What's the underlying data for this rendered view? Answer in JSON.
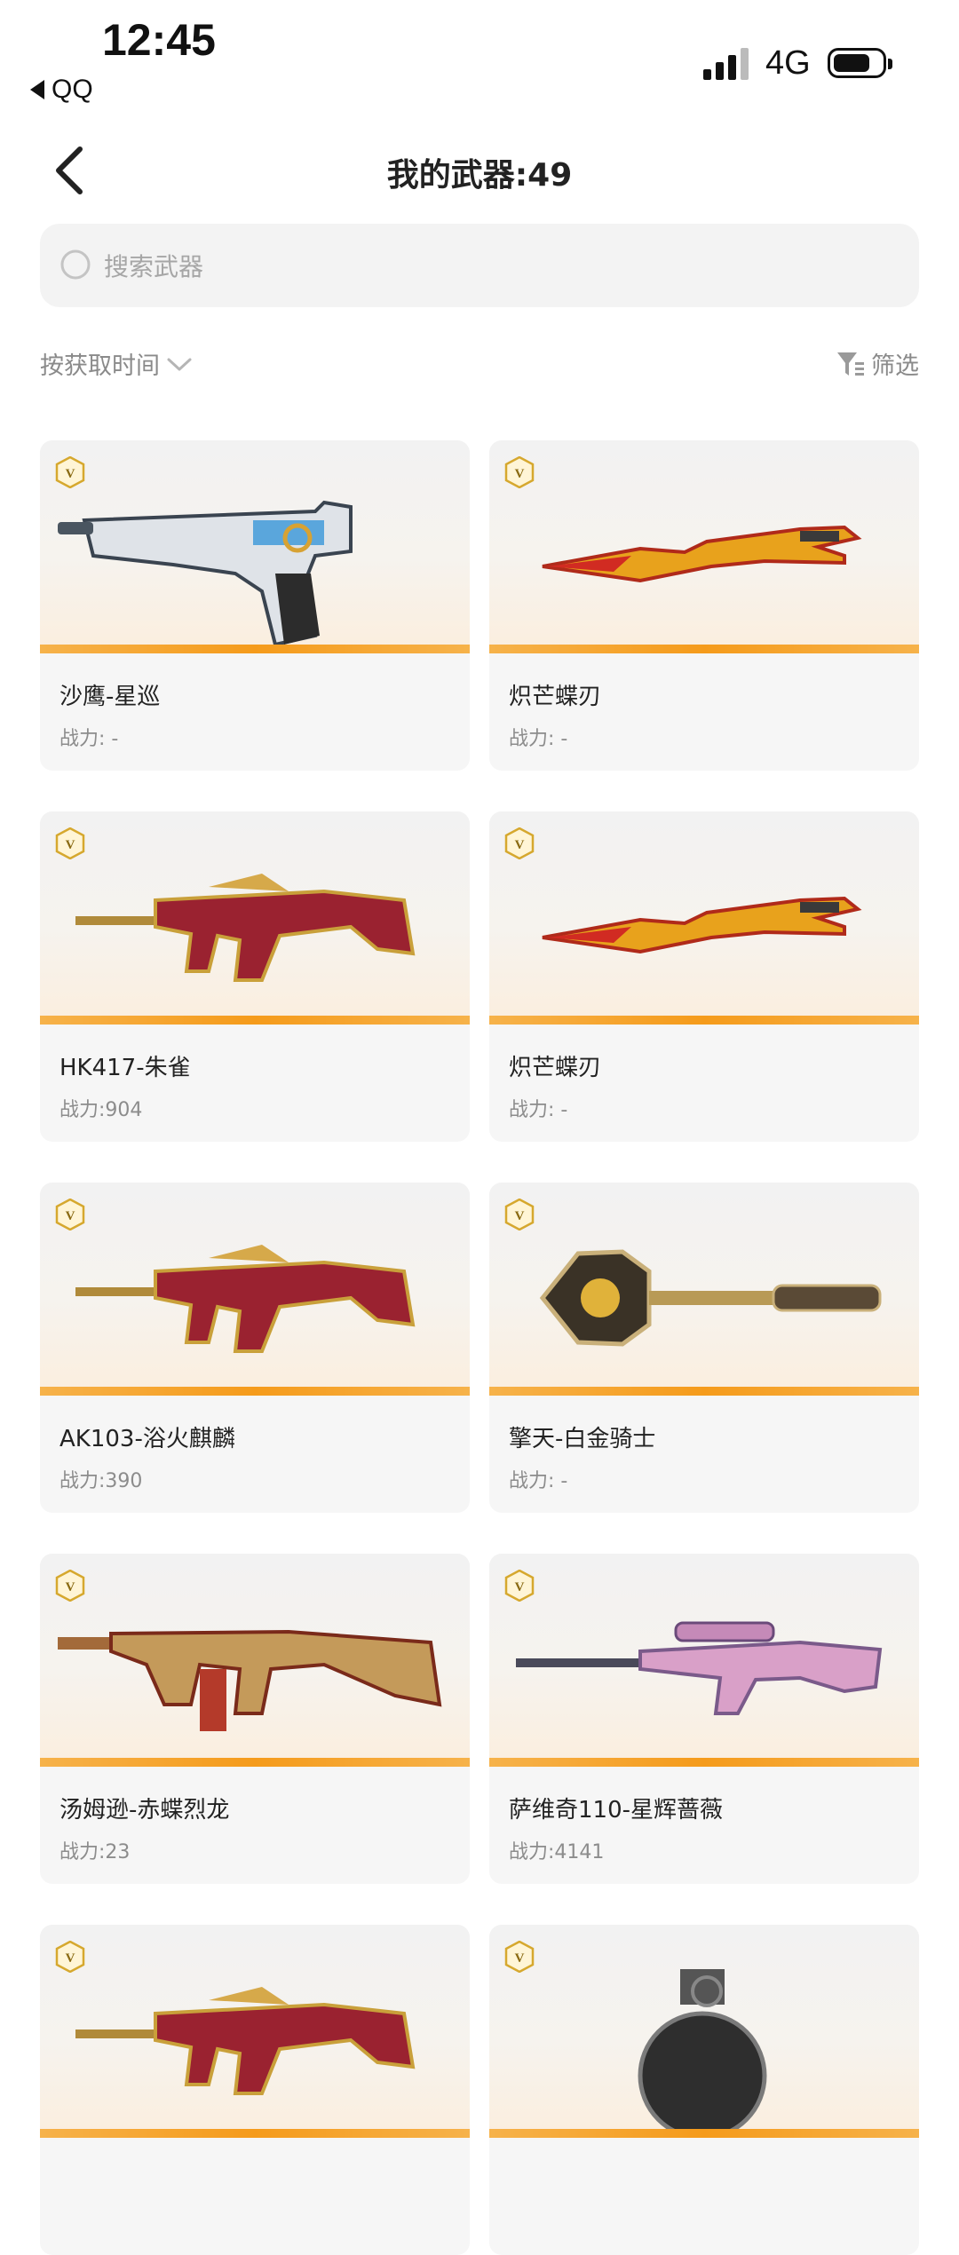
{
  "status_bar": {
    "time": "12:45",
    "back_app": "QQ",
    "network": "4G"
  },
  "header": {
    "title": "我的武器:49"
  },
  "search": {
    "placeholder": "搜索武器"
  },
  "toolbar": {
    "sort_label": "按获取时间",
    "filter_label": "筛选"
  },
  "weapons": [
    {
      "name": "沙鹰-星巡",
      "power": "战力: -",
      "icon": "pistol-icon"
    },
    {
      "name": "炽芒蝶刃",
      "power": "战力: -",
      "icon": "blade-icon"
    },
    {
      "name": "HK417-朱雀",
      "power": "战力:904",
      "icon": "rifle-icon"
    },
    {
      "name": "炽芒蝶刃",
      "power": "战力: -",
      "icon": "blade-icon"
    },
    {
      "name": "AK103-浴火麒麟",
      "power": "战力:390",
      "icon": "rifle-icon"
    },
    {
      "name": "擎天-白金骑士",
      "power": "战力: -",
      "icon": "shovel-icon"
    },
    {
      "name": "汤姆逊-赤蝶烈龙",
      "power": "战力:23",
      "icon": "smg-icon"
    },
    {
      "name": "萨维奇110-星辉蔷薇",
      "power": "战力:4141",
      "icon": "sniper-icon"
    },
    {
      "name": "",
      "power": "",
      "icon": "rifle-icon"
    },
    {
      "name": "",
      "power": "",
      "icon": "grenade-icon"
    }
  ],
  "colors": {
    "accent_stripe": "#f59b1b",
    "card_bg": "#f6f6f6",
    "search_bg": "#f3f3f3"
  }
}
